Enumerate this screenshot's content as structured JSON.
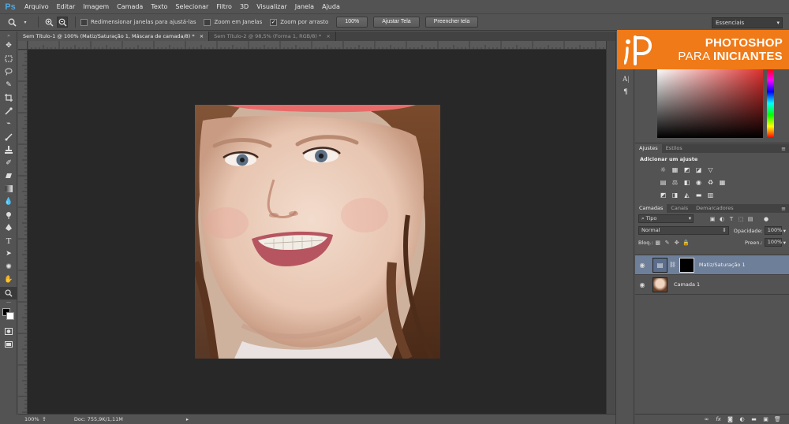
{
  "app": {
    "logo": "Ps",
    "menu": [
      "Arquivo",
      "Editar",
      "Imagem",
      "Camada",
      "Texto",
      "Selecionar",
      "Filtro",
      "3D",
      "Visualizar",
      "Janela",
      "Ajuda"
    ]
  },
  "options": {
    "resize_windows": "Redimensionar janelas para ajustá-las",
    "zoom_all": "Zoom em Janelas",
    "scrubby_zoom": "Zoom por arrasto",
    "btn_100": "100%",
    "btn_fit": "Ajustar Tela",
    "btn_fill": "Preencher tela",
    "workspace": "Essenciais"
  },
  "documents": {
    "tabs": [
      "Sem Título-1 @ 100% (Matiz/Saturação 1, Máscara de camada/8) *",
      "Sem Título-2 @ 98,5% (Forma 1, RGB/8) *"
    ]
  },
  "status": {
    "zoom": "100%",
    "doc": "Doc: 755,9K/1,11M"
  },
  "brand": {
    "line1": "PHOTOSHOP",
    "line2a": "PARA ",
    "line2b": "INICIANTES"
  },
  "adjustments": {
    "tabs": [
      "Ajustes",
      "Estilos"
    ],
    "title": "Adicionar um ajuste"
  },
  "layers": {
    "tabs": [
      "Camadas",
      "Canais",
      "Demarcadores"
    ],
    "filter": "Tipo",
    "blend_mode": "Normal",
    "opacity_label": "Opacidade:",
    "opacity": "100%",
    "lock_label": "Bloq.:",
    "fill_label": "Preen.:",
    "fill": "100%",
    "items": [
      {
        "name": "Matiz/Saturação 1"
      },
      {
        "name": "Camada 1"
      }
    ]
  },
  "colors": {
    "accent_brand": "#f07a17",
    "selected_layer": "#6e7f9a",
    "canvas_bg": "#282828"
  }
}
